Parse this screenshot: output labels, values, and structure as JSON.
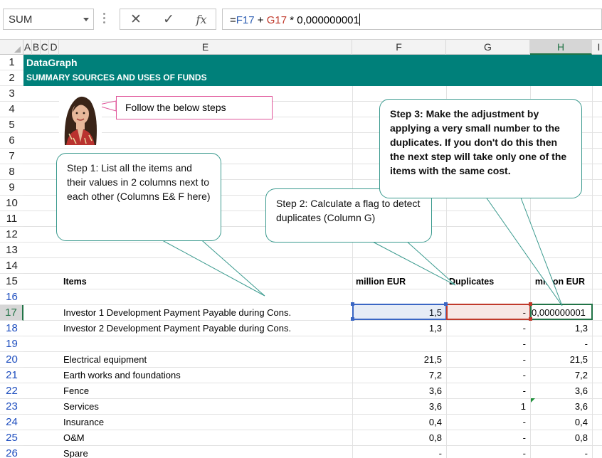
{
  "formula_bar": {
    "name_box": "SUM",
    "cancel_glyph": "✕",
    "enter_glyph": "✓",
    "fx_glyph": "fx",
    "formula_prefix": "=",
    "ref_f": "F17",
    "op1": " + ",
    "ref_g": "G17",
    "rest": " * 0,000000001"
  },
  "columns": [
    "A",
    "B",
    "C",
    "D",
    "E",
    "F",
    "G",
    "H",
    "I"
  ],
  "rows": [
    "1",
    "2",
    "3",
    "4",
    "5",
    "6",
    "7",
    "8",
    "9",
    "10",
    "11",
    "12",
    "13",
    "14",
    "15",
    "16",
    "17",
    "18",
    "19",
    "20",
    "21",
    "22",
    "23",
    "24",
    "25",
    "26"
  ],
  "banner": {
    "title": "DataGraph",
    "subtitle": "SUMMARY SOURCES AND USES OF FUNDS"
  },
  "table": {
    "headers": {
      "items": "Items",
      "million_eur": "million EUR",
      "duplicates": "Duplicates",
      "million_eur_h": "million EUR"
    },
    "rows": [
      {
        "row": "17",
        "item": "Investor 1 Development Payment Payable during Cons.",
        "f": "1,5",
        "g": "-",
        "h": "0,000000001"
      },
      {
        "row": "18",
        "item": "Investor 2 Development Payment Payable during Cons.",
        "f": "1,3",
        "g": "-",
        "h": "1,3"
      },
      {
        "row": "19",
        "item": "",
        "f": "",
        "g": "-",
        "h": "-"
      },
      {
        "row": "20",
        "item": "Electrical equipment",
        "f": "21,5",
        "g": "-",
        "h": "21,5"
      },
      {
        "row": "21",
        "item": "Earth works and foundations",
        "f": "7,2",
        "g": "-",
        "h": "7,2"
      },
      {
        "row": "22",
        "item": "Fence",
        "f": "3,6",
        "g": "-",
        "h": "3,6"
      },
      {
        "row": "23",
        "item": "Services",
        "f": "3,6",
        "g": "1",
        "h": "3,6"
      },
      {
        "row": "24",
        "item": "Insurance",
        "f": "0,4",
        "g": "-",
        "h": "0,4"
      },
      {
        "row": "25",
        "item": "O&M",
        "f": "0,8",
        "g": "-",
        "h": "0,8"
      },
      {
        "row": "26",
        "item": "Spare",
        "f": "-",
        "g": "-",
        "h": "-"
      }
    ]
  },
  "callouts": {
    "note": "Follow the below steps",
    "step1": "Step 1: List all the items and their values in 2 columns next to each other (Columns E& F here)",
    "step2": "Step 2: Calculate a flag to detect duplicates (Column G)",
    "step3": "Step 3: Make the adjustment by applying a very small number to the duplicates. If you don't do this then the next step will take only one of the items with the same cost."
  },
  "colors": {
    "banner": "#00807a",
    "callout_border": "#3a9a8e",
    "note_border": "#e0559a",
    "selection": "#217346",
    "ref_f": "#2e5fb3",
    "ref_g": "#c0392b"
  }
}
